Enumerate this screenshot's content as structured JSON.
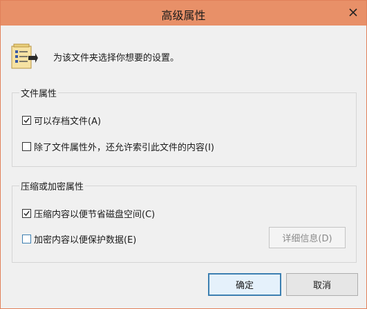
{
  "window": {
    "title": "高级属性",
    "description": "为该文件夹选择你想要的设置。"
  },
  "file_attributes": {
    "group_label": "文件属性",
    "options": [
      {
        "label": "可以存档文件(A)",
        "checked": true
      },
      {
        "label": "除了文件属性外，还允许索引此文件的内容(I)",
        "checked": false
      }
    ]
  },
  "compress_encrypt": {
    "group_label": "压缩或加密属性",
    "options": [
      {
        "label": "压缩内容以便节省磁盘空间(C)",
        "checked": true
      },
      {
        "label": "加密内容以便保护数据(E)",
        "checked": false
      }
    ],
    "details_label": "详细信息(D)",
    "details_enabled": false
  },
  "buttons": {
    "ok_label": "确定",
    "cancel_label": "取消"
  },
  "icons": {
    "title_close": "close-icon",
    "header": "folder-attributes-icon",
    "check": "checkmark-icon"
  },
  "colors": {
    "titlebar": "#e89068",
    "window_border": "#e1805a",
    "focus_blue": "#3c7fb1"
  }
}
